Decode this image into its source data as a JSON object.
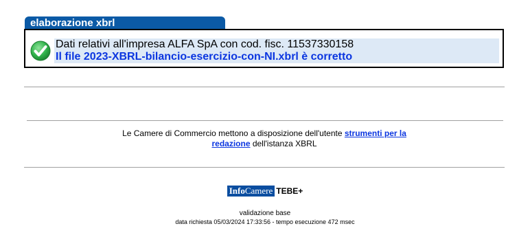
{
  "section_tab": "elaborazione xbrl",
  "result": {
    "status_icon": "checkmark-icon",
    "company_line": "Dati relativi all'impresa ALFA SpA con cod. fisc. 11537330158",
    "file_message": "Il file 2023-XBRL-bilancio-esercizio-con-NI.xbrl è corretto"
  },
  "info": {
    "text_before": "Le Camere di Commercio mettono a disposizione dell'utente ",
    "link_part1": "strumenti per la",
    "link_part2": "redazione",
    "text_after": " dell'istanza XBRL"
  },
  "branding": {
    "logo_part1": "Info",
    "logo_part2": "Camere",
    "product": "TEBE+"
  },
  "footer": {
    "mode": "validazione base",
    "details": "data richiesta 05/03/2024 17:33:56 - tempo esecuzione 472 msec"
  },
  "colors": {
    "tab_bg": "#0b5aa6",
    "message_bg": "#dde9f6",
    "message_text": "#0b36e0",
    "success_green": "#2fb24a"
  }
}
